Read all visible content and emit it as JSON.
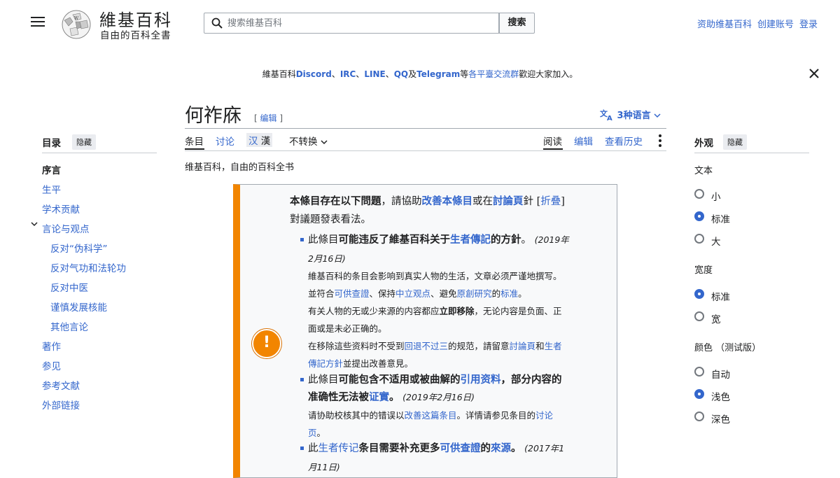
{
  "header": {
    "logo_title": "維基百科",
    "logo_tagline": "自由的百科全書",
    "search_placeholder": "搜索维基百科",
    "search_button": "搜索",
    "user_links": [
      "资助维基百科",
      "创建账号",
      "登录"
    ]
  },
  "sitenotice": {
    "prefix": "維基百科",
    "discord": "Discord",
    "sep1": "、",
    "irc": "IRC",
    "sep2": "、",
    "line": "LINE",
    "sep3": "、",
    "qq": "QQ",
    "and": "及",
    "telegram": "Telegram",
    "mid": "等",
    "platforms": "各平臺交流群",
    "suffix": "歡迎大家加入。"
  },
  "page": {
    "title": "何祚庥",
    "edit": "编辑",
    "languages": "3种语言",
    "site_sub": "维基百科，自由的百科全书"
  },
  "tabs": {
    "article": "条目",
    "talk": "讨论",
    "variant_hans": "汉",
    "variant_hant": "漢",
    "no_convert": "不转换",
    "read": "阅读",
    "edit": "编辑",
    "history": "查看历史"
  },
  "toc": {
    "heading": "目录",
    "hide": "隐藏",
    "items": [
      {
        "label": "序言"
      },
      {
        "label": "生平"
      },
      {
        "label": "学术贡献"
      },
      {
        "label": "言论与观点"
      },
      {
        "label": "反对“伪科学”"
      },
      {
        "label": "反对气功和法轮功"
      },
      {
        "label": "反对中医"
      },
      {
        "label": "谨慎发展核能"
      },
      {
        "label": "其他言论"
      },
      {
        "label": "著作"
      },
      {
        "label": "参见"
      },
      {
        "label": "参考文献"
      },
      {
        "label": "外部链接"
      }
    ]
  },
  "appearance": {
    "heading": "外观",
    "hide": "隐藏",
    "text_label": "文本",
    "text_options": [
      "小",
      "标准",
      "大"
    ],
    "text_selected": "标准",
    "width_label": "宽度",
    "width_options": [
      "标准",
      "宽"
    ],
    "width_selected": "标准",
    "color_label": "颜色 （测试版）",
    "color_options": [
      "自动",
      "浅色",
      "深色"
    ],
    "color_selected": "浅色"
  },
  "ambox": {
    "intro_a": "本條目存在以下問題",
    "intro_b": "，請協助",
    "intro_link1": "改善本條目",
    "intro_c": "或在",
    "intro_link2": "討論頁",
    "intro_d": "針",
    "collapse_open": "[",
    "collapse": "折叠",
    "collapse_close": "]",
    "intro_e": "對議題發表看法。",
    "i1_a": "此條目",
    "i1_b": "可能违反了維基百科关于",
    "i1_link": "生者傳記",
    "i1_c": "的方針",
    "i1_d": "。",
    "i1_date_a": "(2019年",
    "i1_date_b": "2月16日)",
    "i1_l1": "維基百科的条目会影响到真实人物的生活，文章必须严谨地撰写。",
    "i1_l2_a": "並符合",
    "i1_l2_link1": "可供查證",
    "i1_l2_b": "、保持",
    "i1_l2_link2": "中立观点",
    "i1_l2_c": "、避免",
    "i1_l2_link3": "原創研究",
    "i1_l2_d": "的",
    "i1_l2_link4": "标准",
    "i1_l2_e": "。",
    "i1_l3_a": "有关人物的无或少来源的内容都应",
    "i1_l3_b": "立即移除",
    "i1_l3_c": "，无论内容是负面、正",
    "i1_l4": "面或是未必正确的。",
    "i1_l5_a": "在移除這些资料时不受到",
    "i1_l5_link1": "回退不过三",
    "i1_l5_b": "的规范，請留意",
    "i1_l5_link2": "討論頁",
    "i1_l5_c": "和",
    "i1_l5_link3": "生者",
    "i1_l6_link": "傳記方針",
    "i1_l6_b": "並提出改善意見。",
    "i2_a": "此條目",
    "i2_b": "可能包含不适用或被曲解的",
    "i2_link": "引用资料",
    "i2_c": "，部分内容的",
    "i2_d": "准确性无法被",
    "i2_link2": "证實",
    "i2_e": "。",
    "i2_date": "(2019年2月16日)",
    "i2_l1_a": "请协助校核其中的错误以",
    "i2_l1_link": "改善这篇条目",
    "i2_l1_b": "。详情请参见条目的",
    "i2_l1_link2": "讨论",
    "i2_l2_link": "页",
    "i2_l2_b": "。",
    "i3_a": "此",
    "i3_link": "生者传记",
    "i3_b": "条目需要补充更多",
    "i3_link2": "可供查證",
    "i3_c": "的",
    "i3_link3": "來源",
    "i3_d": "。",
    "i3_date_a": "(2017年1",
    "i3_date_b": "月11日)"
  },
  "colors": {
    "link": "#3366cc",
    "ambox_border": "#f28500",
    "text": "#202122"
  },
  "icons": [
    "menu-icon",
    "wikipedia-globe-logo",
    "search-icon",
    "close-icon",
    "translate-icon",
    "chevron-down-icon",
    "more-icon",
    "warning-icon"
  ]
}
